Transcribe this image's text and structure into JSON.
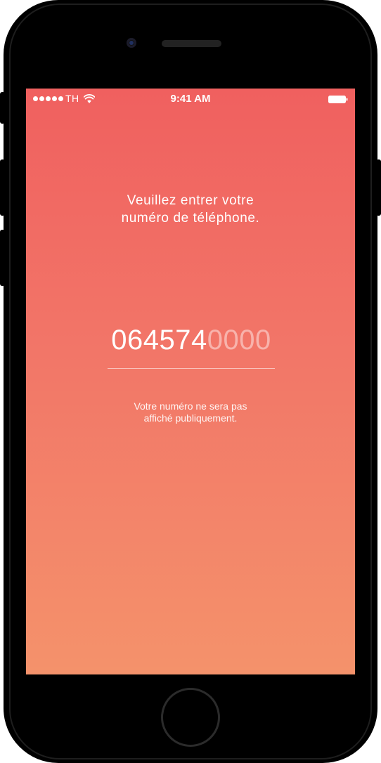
{
  "status_bar": {
    "carrier": "TH",
    "time": "9:41 AM",
    "icons": [
      "signal-dots-icon",
      "wifi-icon",
      "battery-icon"
    ]
  },
  "prompt": {
    "line1": "Veuillez entrer votre",
    "line2": "numéro de téléphone."
  },
  "phone_field": {
    "entered": "064574",
    "placeholder_remaining": "0000"
  },
  "privacy_note": {
    "line1": "Votre numéro ne sera pas",
    "line2": "affiché publiquement."
  },
  "colors": {
    "gradient_top": "#f0605f",
    "gradient_bottom": "#f4926b",
    "text": "#ffffff",
    "device": "#000000"
  }
}
